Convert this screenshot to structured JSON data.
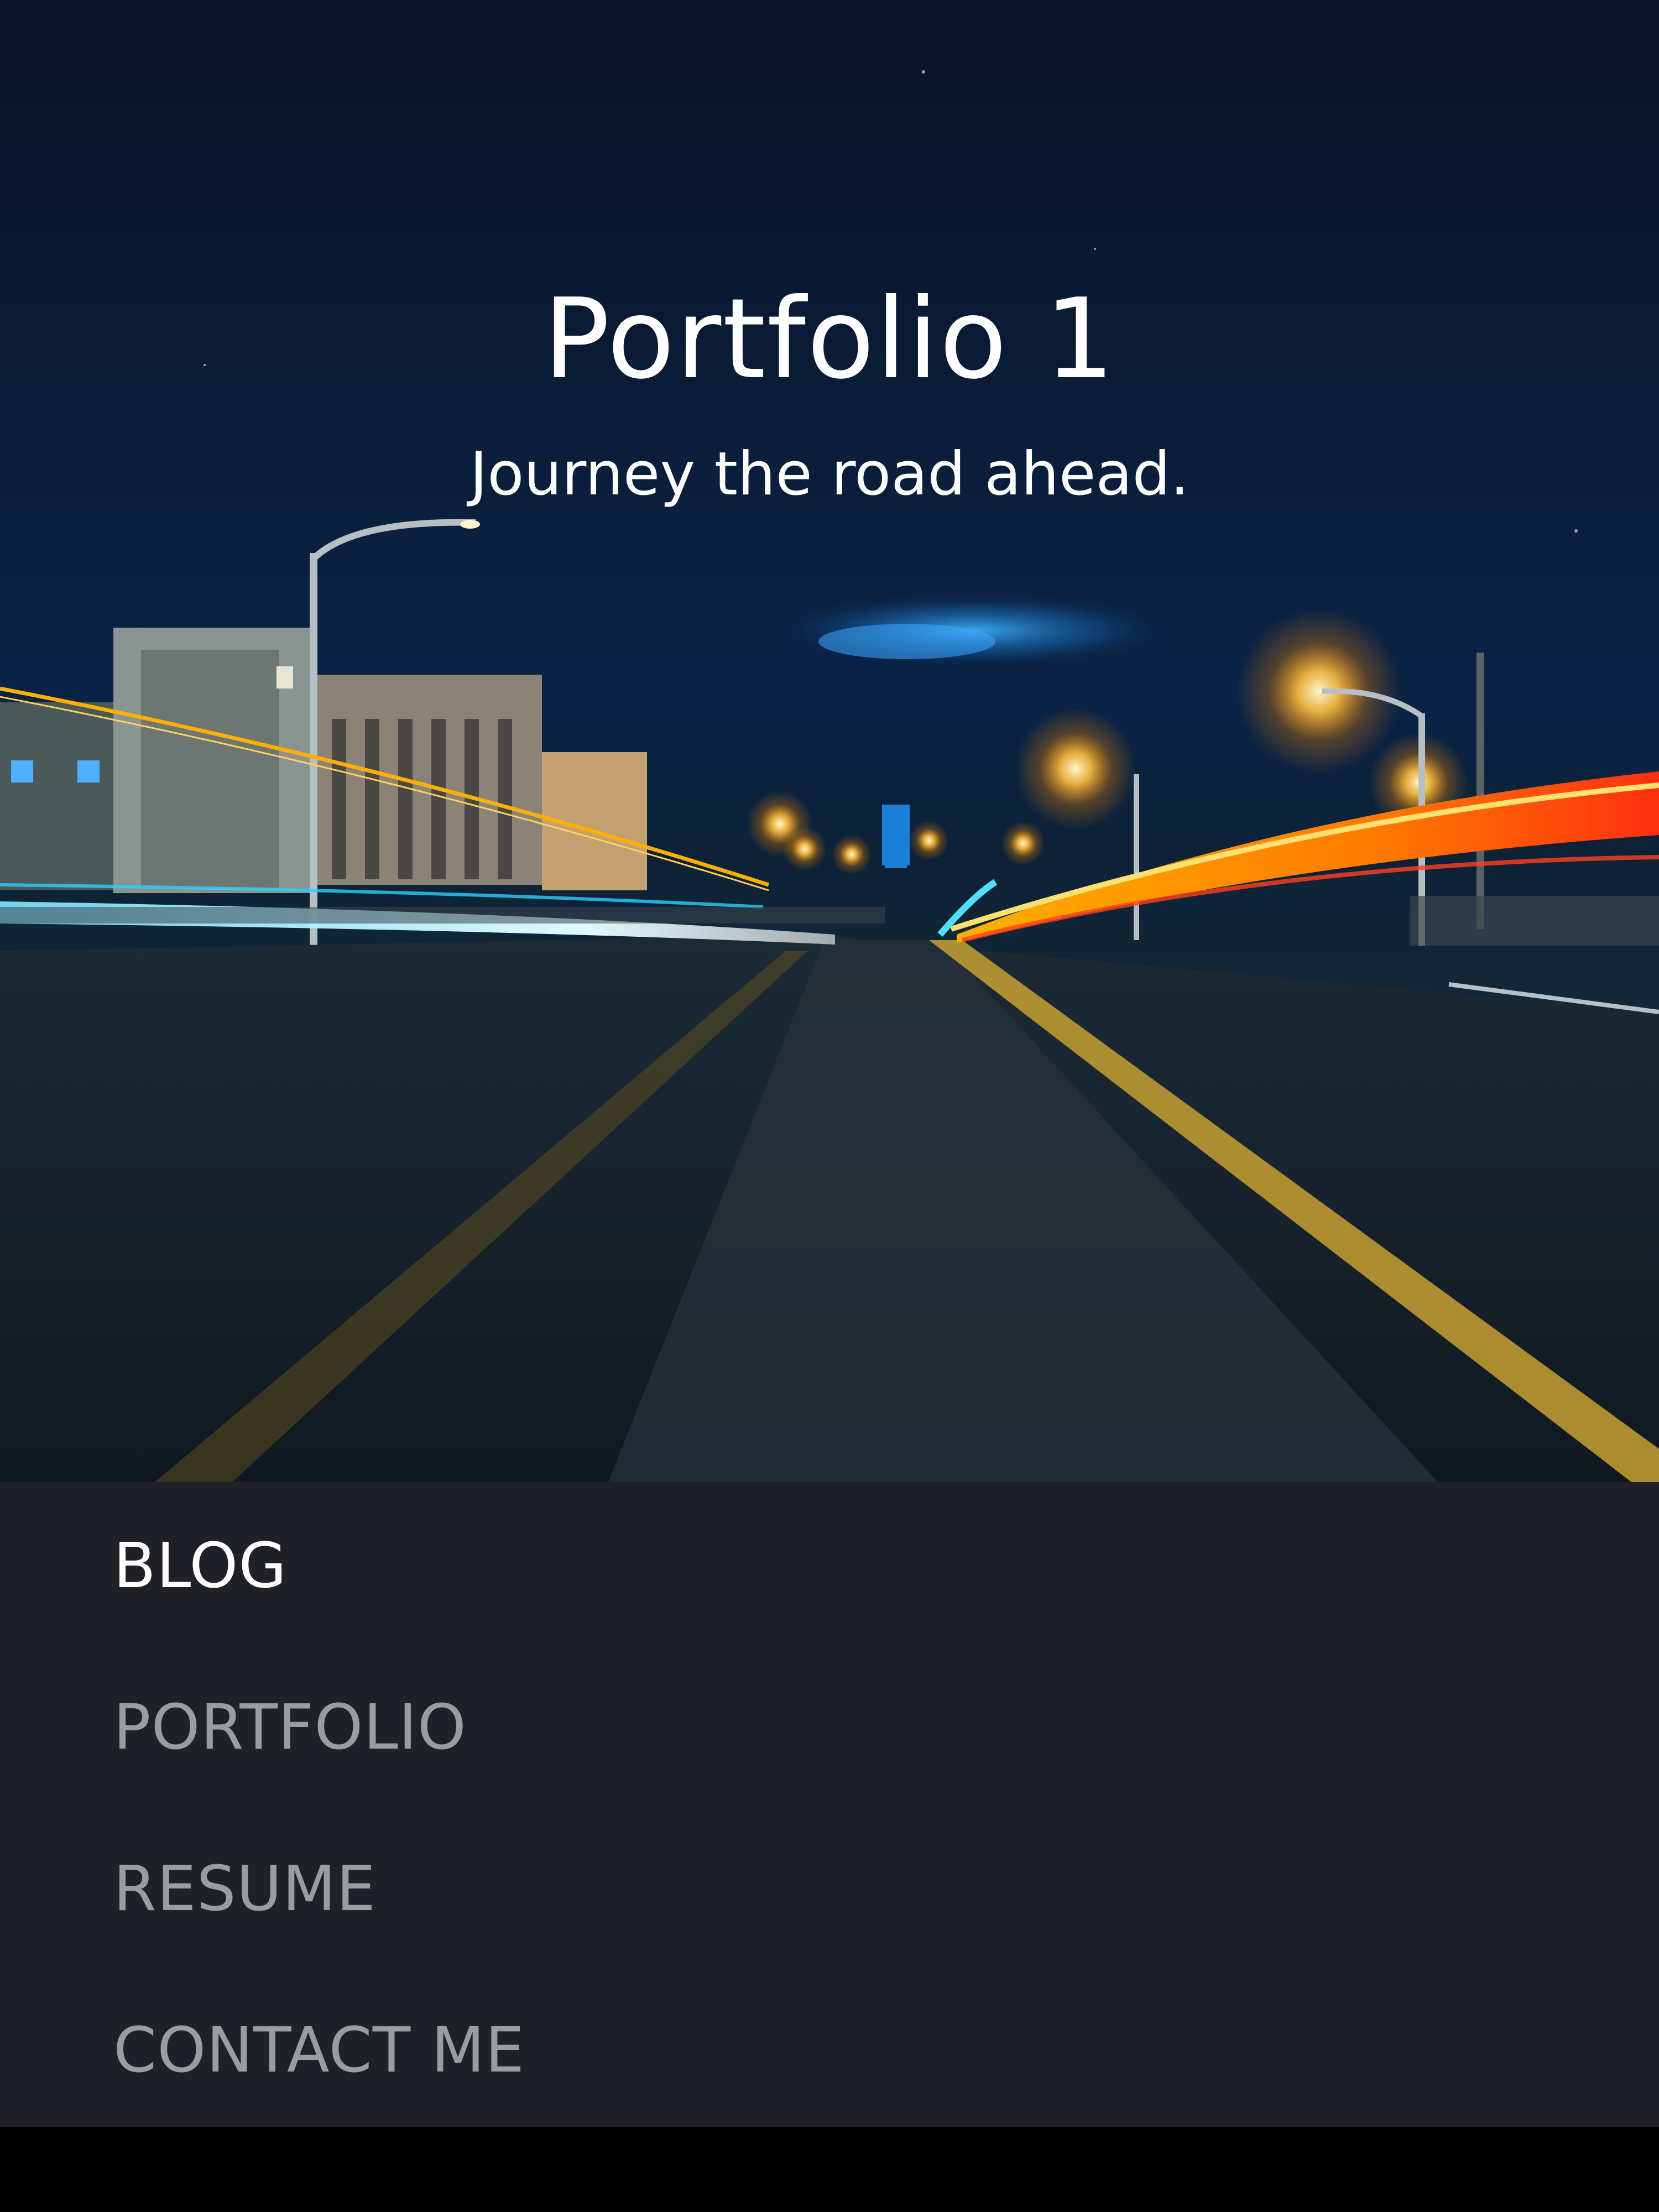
{
  "hero": {
    "title": "Portfolio 1",
    "subtitle": "Journey the road ahead.",
    "image": "night-highway-light-trails-photo"
  },
  "nav": {
    "items": [
      {
        "label": "BLOG",
        "active": true
      },
      {
        "label": "PORTFOLIO",
        "active": false
      },
      {
        "label": "RESUME",
        "active": false
      },
      {
        "label": "CONTACT ME",
        "active": false
      }
    ]
  },
  "colors": {
    "nav_background": "#1f2126",
    "nav_active_text": "#ffffff",
    "nav_inactive_text": "#9a9ca0",
    "hero_sky": "#0a1f3d",
    "light_trail_warm": "#ff8a00",
    "light_trail_cool": "#21d4ff",
    "bottom_bar": "#000000"
  }
}
